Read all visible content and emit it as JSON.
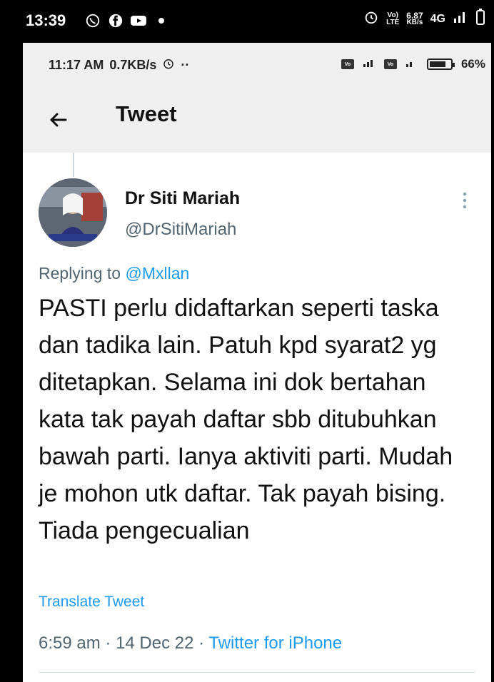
{
  "phone_status": {
    "time": "13:39",
    "net_top": "6.87",
    "net_unit": "KB/s",
    "volte_top": "Vo)",
    "volte_bottom": "LTE",
    "network": "4G"
  },
  "inner_status": {
    "time": "11:17 AM",
    "speed": "0.7KB/s",
    "dots": "··",
    "battery": "66%"
  },
  "header": {
    "title": "Tweet"
  },
  "tweet": {
    "name": "Dr Siti Mariah",
    "handle": "@DrSitiMariah",
    "replying_prefix": "Replying to ",
    "replying_to": "@Mxllan",
    "text": "PASTI perlu didaftarkan seperti taska dan tadika lain. Patuh kpd syarat2 yg ditetapkan. Selama ini dok bertahan kata tak payah daftar sbb ditubuhkan bawah parti. Ianya aktiviti parti. Mudah je mohon utk daftar. Tak payah bising. Tiada pengecualian",
    "translate": "Translate Tweet",
    "timestamp": "6:59 am · 14 Dec 22 · ",
    "source": "Twitter for iPhone"
  }
}
